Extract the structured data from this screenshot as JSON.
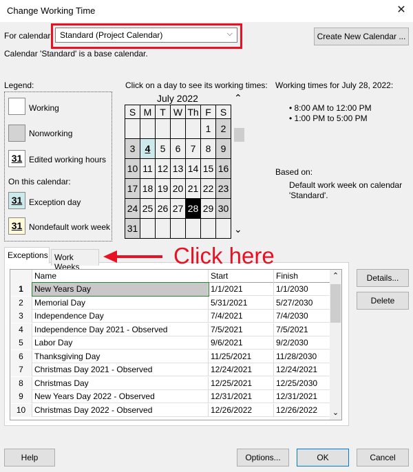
{
  "window": {
    "title": "Change Working Time",
    "close": "✕"
  },
  "calendar_select": {
    "label": "For calendar:",
    "value": "Standard (Project Calendar)",
    "chevron": "⌵"
  },
  "create_new_calendar": "Create New Calendar ...",
  "base_info": "Calendar 'Standard' is a base calendar.",
  "legend": {
    "title": "Legend:",
    "working": "Working",
    "nonworking": "Nonworking",
    "edited": "Edited working hours",
    "edited_num": "31",
    "on_this_calendar": "On this calendar:",
    "exception_day": "Exception day",
    "exception_num": "31",
    "nondefault": "Nondefault work week",
    "nondefault_num": "31"
  },
  "calendar": {
    "instruction": "Click on a day to see its working times:",
    "month": "July 2022",
    "up": "⌃",
    "down": "⌄",
    "days": [
      "S",
      "M",
      "T",
      "W",
      "Th",
      "F",
      "S"
    ],
    "weeks": [
      [
        "",
        "",
        "",
        "",
        "",
        "1",
        "2"
      ],
      [
        "3",
        "4",
        "5",
        "6",
        "7",
        "8",
        "9"
      ],
      [
        "10",
        "11",
        "12",
        "13",
        "14",
        "15",
        "16"
      ],
      [
        "17",
        "18",
        "19",
        "20",
        "21",
        "22",
        "23"
      ],
      [
        "24",
        "25",
        "26",
        "27",
        "28",
        "29",
        "30"
      ],
      [
        "31",
        "",
        "",
        "",
        "",
        "",
        ""
      ]
    ]
  },
  "working_times": {
    "title": "Working times for July 28, 2022:",
    "times": [
      "• 8:00 AM to 12:00 PM",
      "• 1:00 PM to 5:00 PM"
    ],
    "based_on_label": "Based on:",
    "based_on_value": "Default work week on calendar 'Standard'."
  },
  "tabs": {
    "exceptions": "Exceptions",
    "work_weeks": "Work Weeks"
  },
  "annotation": {
    "text": "Click here",
    "color": "#e81123"
  },
  "exceptions_table": {
    "headers": [
      "Name",
      "Start",
      "Finish"
    ],
    "rows": [
      [
        "1",
        "New Years Day",
        "1/1/2021",
        "1/1/2030"
      ],
      [
        "2",
        "Memorial Day",
        "5/31/2021",
        "5/27/2030"
      ],
      [
        "3",
        "Independence Day",
        "7/4/2021",
        "7/4/2030"
      ],
      [
        "4",
        "Independence Day 2021 - Observed",
        "7/5/2021",
        "7/5/2021"
      ],
      [
        "5",
        "Labor Day",
        "9/6/2021",
        "9/2/2030"
      ],
      [
        "6",
        "Thanksgiving Day",
        "11/25/2021",
        "11/28/2030"
      ],
      [
        "7",
        "Christmas Day 2021 - Observed",
        "12/24/2021",
        "12/24/2021"
      ],
      [
        "8",
        "Christmas Day",
        "12/25/2021",
        "12/25/2030"
      ],
      [
        "9",
        "New Years Day 2022 - Observed",
        "12/31/2021",
        "12/31/2021"
      ],
      [
        "10",
        "Christmas Day 2022 - Observed",
        "12/26/2022",
        "12/26/2022"
      ]
    ]
  },
  "buttons": {
    "details": "Details...",
    "delete": "Delete",
    "help": "Help",
    "options": "Options...",
    "ok": "OK",
    "cancel": "Cancel"
  },
  "colors": {
    "accent": "#e81123",
    "exception": "#cce9ec",
    "nonworking": "#d3d3d3",
    "edited_hours": "#fffbd8",
    "selected_row": "#c8c8c8"
  }
}
